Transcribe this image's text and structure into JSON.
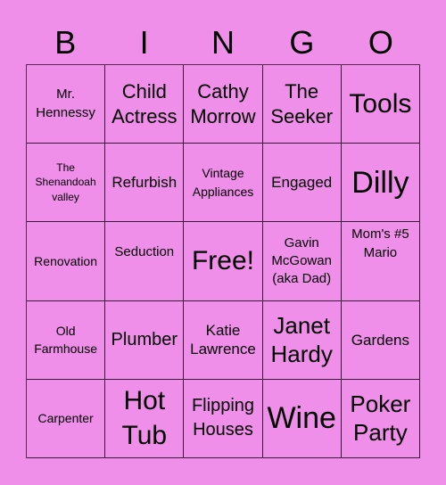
{
  "card": {
    "background_color": "#f08fe9",
    "header_letters": [
      "B",
      "I",
      "N",
      "G",
      "O"
    ],
    "cells": [
      {
        "text": "Mr. Hennessy"
      },
      {
        "text": "Child Actress"
      },
      {
        "text": "Cathy Morrow"
      },
      {
        "text": "The Seeker"
      },
      {
        "text": "Tools"
      },
      {
        "text": "The Shenandoah valley"
      },
      {
        "text": "Refurbish"
      },
      {
        "text": "Vintage Appliances"
      },
      {
        "text": "Engaged"
      },
      {
        "text": "Dilly"
      },
      {
        "text": "Renovation"
      },
      {
        "text": "Seduction"
      },
      {
        "text": "Free!"
      },
      {
        "text": "Gavin McGowan (aka Dad)"
      },
      {
        "text": "Mom's #5 Mario"
      },
      {
        "text": "Old Farmhouse"
      },
      {
        "text": "Plumber"
      },
      {
        "text": "Katie Lawrence"
      },
      {
        "text": "Janet Hardy"
      },
      {
        "text": "Gardens"
      },
      {
        "text": "Carpenter"
      },
      {
        "text": "Hot Tub"
      },
      {
        "text": "Flipping Houses"
      },
      {
        "text": "Wine"
      },
      {
        "text": "Poker Party"
      }
    ]
  }
}
